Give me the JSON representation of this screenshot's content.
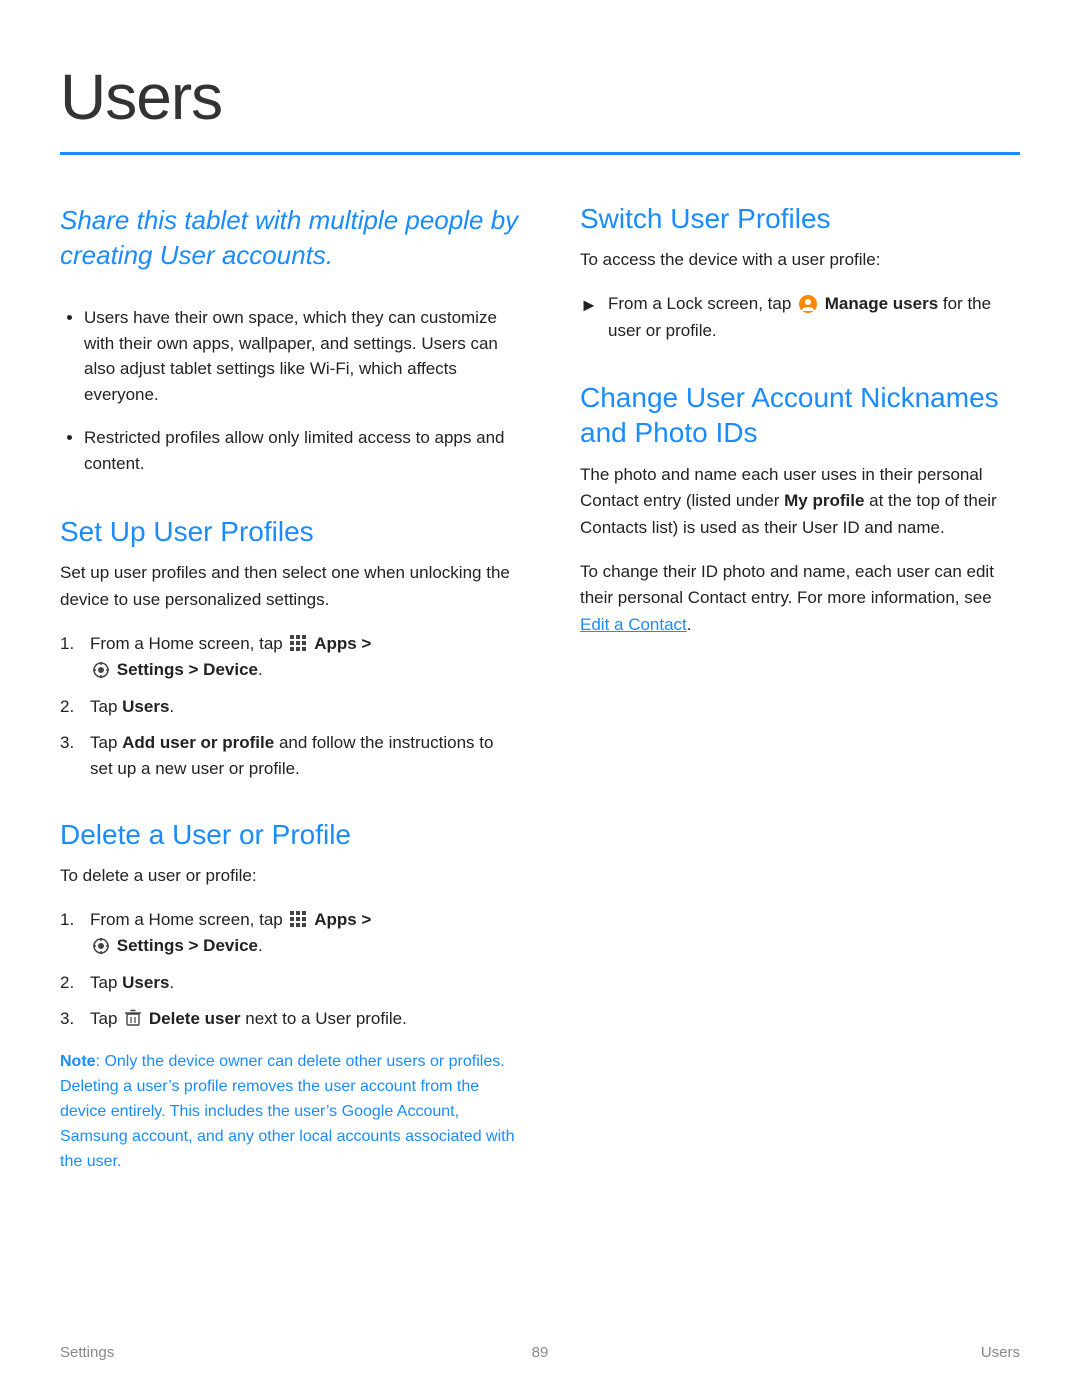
{
  "page": {
    "title": "Users",
    "footer": {
      "left": "Settings",
      "center": "89",
      "right": "Users"
    }
  },
  "left_col": {
    "intro": "Share this tablet with multiple people by creating User accounts.",
    "bullets": [
      "Users have their own space, which they can customize with their own apps, wallpaper, and settings. Users can also adjust tablet settings like Wi-Fi, which affects everyone.",
      "Restricted profiles allow only limited access to apps and content."
    ],
    "set_up": {
      "title": "Set Up User Profiles",
      "body": "Set up user profiles and then select one when unlocking the device to use personalized settings.",
      "steps": [
        {
          "num": "1.",
          "text_before": "From a Home screen, tap",
          "apps_icon": true,
          "apps_label": "Apps >",
          "settings_icon": true,
          "settings_label": "Settings > Device."
        },
        {
          "num": "2.",
          "text": "Tap",
          "bold": "Users",
          "text_after": "."
        },
        {
          "num": "3.",
          "text": "Tap",
          "bold": "Add user or profile",
          "text_after": "and follow the instructions to set up a new user or profile."
        }
      ]
    },
    "delete": {
      "title": "Delete a User or Profile",
      "body": "To delete a user or profile:",
      "steps": [
        {
          "num": "1.",
          "text_before": "From a Home screen, tap",
          "apps_icon": true,
          "apps_label": "Apps >",
          "settings_icon": true,
          "settings_label": "Settings > Device."
        },
        {
          "num": "2.",
          "text": "Tap",
          "bold": "Users",
          "text_after": "."
        },
        {
          "num": "3.",
          "text": "Tap",
          "delete_icon": true,
          "bold": "Delete user",
          "text_after": "next to a User profile."
        }
      ],
      "note_label": "Note",
      "note_text": ": Only the device owner can delete other users or profiles. Deleting a user’s profile removes the user account from the device entirely. This includes the user’s Google Account, Samsung account, and any other local accounts associated with the user."
    }
  },
  "right_col": {
    "switch": {
      "title": "Switch User Profiles",
      "body": "To access the device with a user profile:",
      "step": {
        "text_before": "From a Lock screen, tap",
        "manage_icon": true,
        "bold": "Manage users",
        "text_after": "for the user or profile."
      }
    },
    "change": {
      "title": "Change User Account Nicknames and Photo IDs",
      "body1": "The photo and name each user uses in their personal Contact entry (listed under",
      "bold1": "My profile",
      "body1_after": "at the top of their Contacts list) is used as their User ID and name.",
      "body2": "To change their ID photo and name, each user can edit their personal Contact entry. For more information, see",
      "link": "Edit a Contact",
      "body2_after": "."
    }
  }
}
